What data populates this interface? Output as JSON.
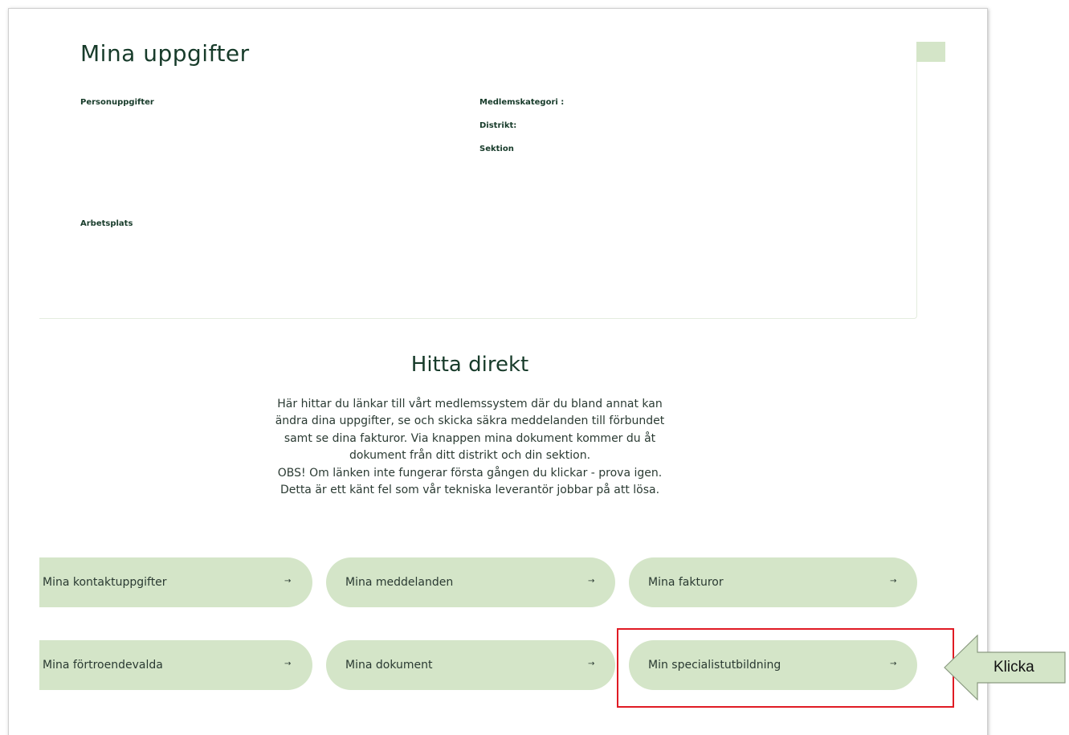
{
  "profile": {
    "title": "Mina uppgifter",
    "personal_label": "Personuppgifter",
    "category_label": "Medlemskategori :",
    "district_label": "Distrikt:",
    "section_label": "Sektion",
    "workplace_label": "Arbetsplats"
  },
  "quick_links": {
    "title": "Hitta direkt",
    "intro_lines": [
      "Här hittar du länkar till vårt medlemssystem där du bland annat kan",
      "ändra dina uppgifter, se och skicka säkra meddelanden till förbundet",
      "samt se dina fakturor. Via knappen mina dokument kommer du åt",
      "dokument från ditt distrikt och din sektion.",
      "OBS! Om länken inte fungerar första gången du klickar - prova igen.",
      "Detta är ett känt fel som vår tekniska leverantör jobbar på att lösa."
    ],
    "arrow_glyph": "→",
    "links": [
      {
        "label": "Mina kontaktuppgifter"
      },
      {
        "label": "Mina meddelanden"
      },
      {
        "label": "Mina fakturor"
      },
      {
        "label": "Mina förtroendevalda"
      },
      {
        "label": "Mina dokument"
      },
      {
        "label": "Min specialistutbildning"
      }
    ]
  },
  "annotation": {
    "label": "Klicka",
    "box_color": "#e01b24",
    "arrow_fill": "#d4e5c8"
  },
  "colors": {
    "pill_bg": "#d4e5c8",
    "heading": "#173b2a"
  }
}
